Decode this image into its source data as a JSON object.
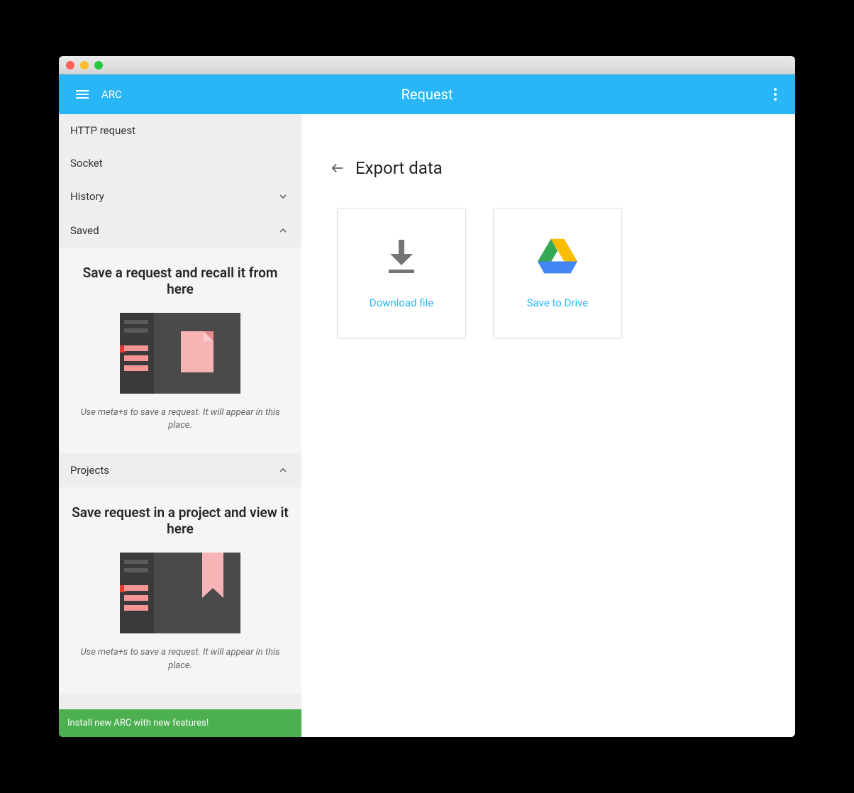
{
  "app": {
    "name": "ARC",
    "title": "Request"
  },
  "sidebar": {
    "items": [
      {
        "label": "HTTP request",
        "expandable": false
      },
      {
        "label": "Socket",
        "expandable": false
      },
      {
        "label": "History",
        "expandable": true,
        "expanded": false
      },
      {
        "label": "Saved",
        "expandable": true,
        "expanded": true
      },
      {
        "label": "Projects",
        "expandable": true,
        "expanded": true
      }
    ],
    "saved_panel": {
      "title": "Save a request and recall it from here",
      "hint": "Use meta+s to save a request. It will appear in this place."
    },
    "projects_panel": {
      "title": "Save request in a project and view it here",
      "hint": "Use meta+s to save a request. It will appear in this place."
    },
    "install_banner": "Install new ARC with new features!"
  },
  "main": {
    "page_title": "Export data",
    "cards": {
      "download": {
        "label": "Download file"
      },
      "drive": {
        "label": "Save to Drive"
      }
    }
  },
  "colors": {
    "primary": "#29b6f6",
    "banner": "#4caf50"
  }
}
